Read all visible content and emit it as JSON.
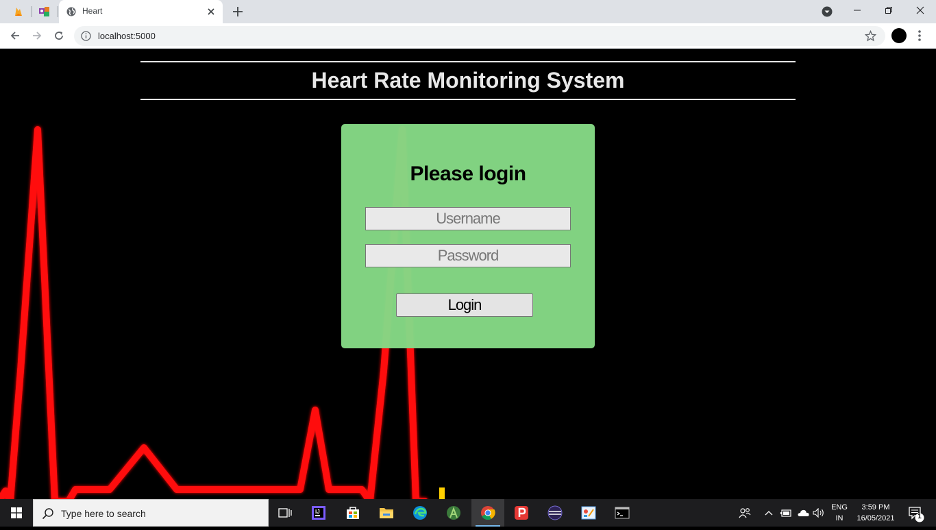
{
  "browser": {
    "tab_title": "Heart",
    "url": "localhost:5000"
  },
  "page": {
    "title": "Heart Rate Monitoring System",
    "login": {
      "heading": "Please login",
      "username_placeholder": "Username",
      "password_placeholder": "Password",
      "button_label": "Login"
    }
  },
  "taskbar": {
    "search_placeholder": "Type here to search",
    "lang_line1": "ENG",
    "lang_line2": "IN",
    "time": "3:59 PM",
    "date": "16/05/2021",
    "notification_count": "1"
  },
  "colors": {
    "page_background": "#000000",
    "card_background": "#85d985",
    "ecg_line": "#ff0000"
  }
}
